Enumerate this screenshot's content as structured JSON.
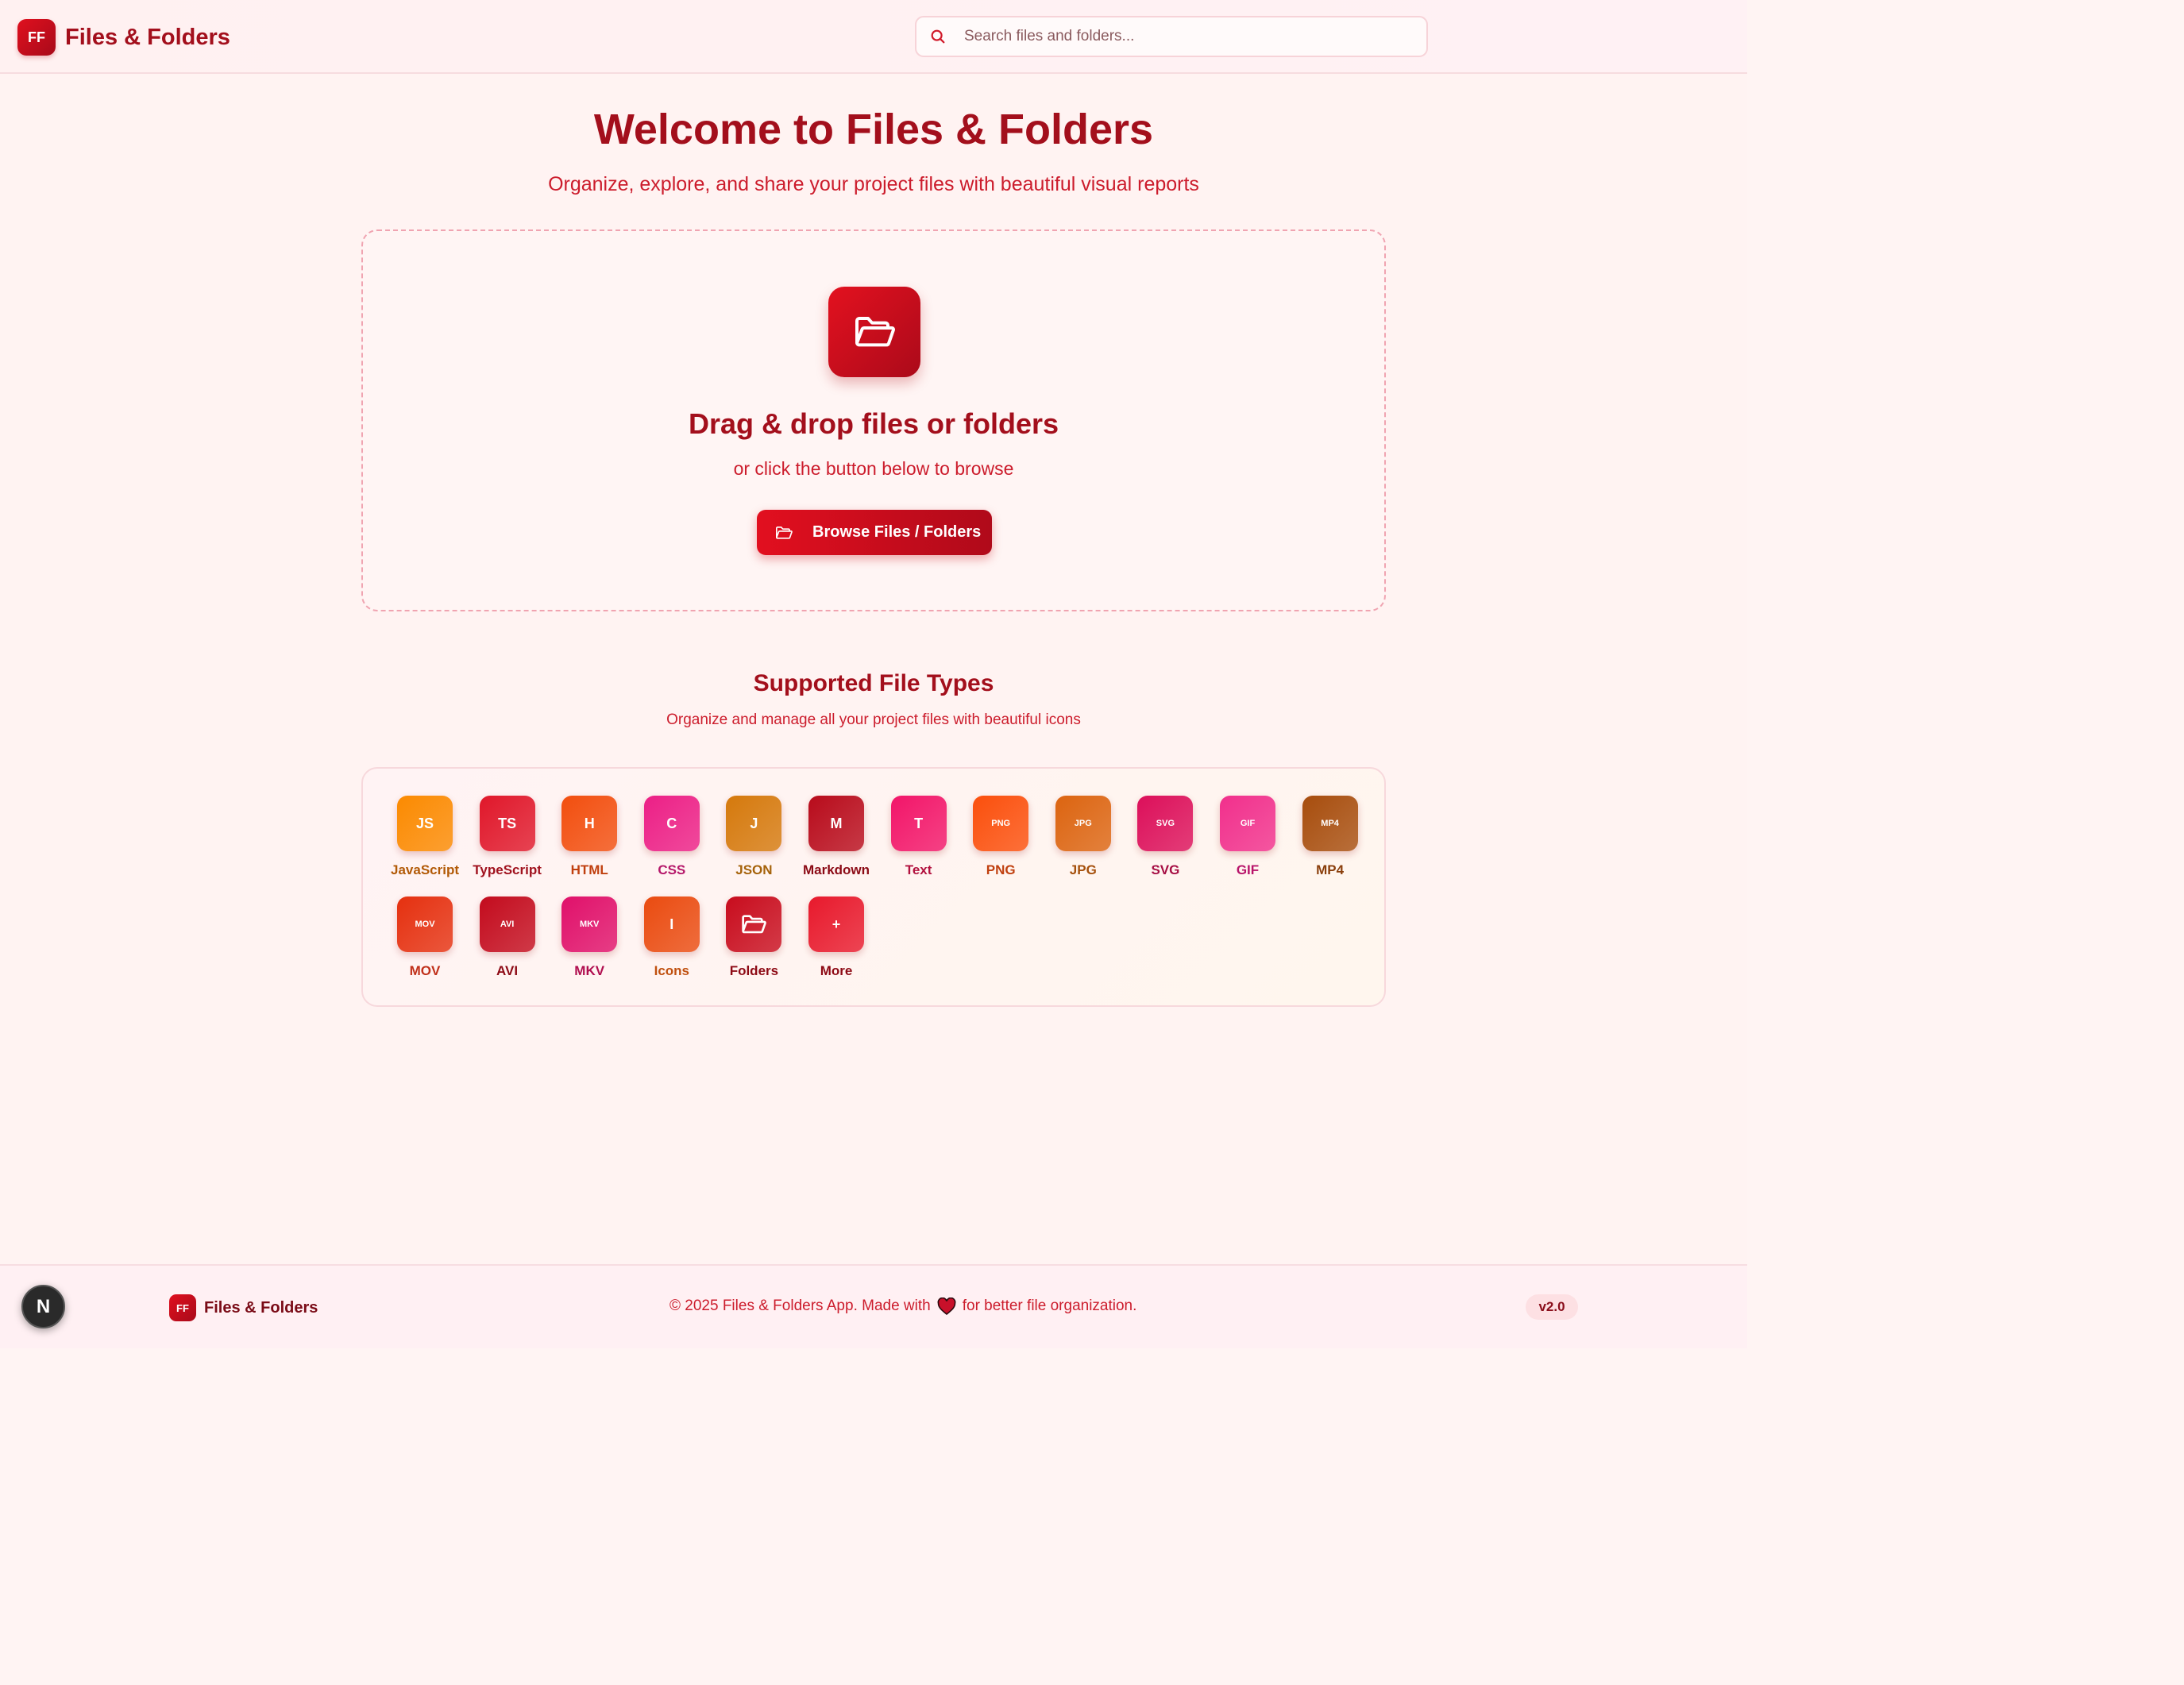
{
  "app": {
    "logo_initials": "FF",
    "name": "Files & Folders"
  },
  "search": {
    "placeholder": "Search files and folders..."
  },
  "hero": {
    "title": "Welcome to Files & Folders",
    "subtitle": "Organize, explore, and share your project files with beautiful visual reports"
  },
  "dropzone": {
    "title": "Drag & drop files or folders",
    "subtitle": "or click the button below to browse",
    "button_label": "Browse Files / Folders"
  },
  "file_types": {
    "title": "Supported File Types",
    "subtitle": "Organize and manage all your project files with beautiful icons",
    "items": [
      {
        "badge": "JS",
        "label": "JavaScript",
        "color": "#fb8a00",
        "text_color": "#b25a06"
      },
      {
        "badge": "TS",
        "label": "TypeScript",
        "color": "#e0172a",
        "text_color": "#a0121e"
      },
      {
        "badge": "H",
        "label": "HTML",
        "color": "#f24e0e",
        "text_color": "#c0400f"
      },
      {
        "badge": "C",
        "label": "CSS",
        "color": "#ec1f86",
        "text_color": "#b5176a"
      },
      {
        "badge": "J",
        "label": "JSON",
        "color": "#d5790c",
        "text_color": "#a5620a"
      },
      {
        "badge": "M",
        "label": "Markdown",
        "color": "#b80b1b",
        "text_color": "#8b0a15"
      },
      {
        "badge": "T",
        "label": "Text",
        "color": "#f21569",
        "text_color": "#b2123f"
      },
      {
        "badge": "PNG",
        "label": "PNG",
        "color": "#fb4f0c",
        "text_color": "#c0400f"
      },
      {
        "badge": "JPG",
        "label": "JPG",
        "color": "#dc6410",
        "text_color": "#a5500c"
      },
      {
        "badge": "SVG",
        "label": "SVG",
        "color": "#dc0f5a",
        "text_color": "#a60e44"
      },
      {
        "badge": "GIF",
        "label": "GIF",
        "color": "#f12f8c",
        "text_color": "#b8146a"
      },
      {
        "badge": "MP4",
        "label": "MP4",
        "color": "#a74d0d",
        "text_color": "#8a3f0c"
      },
      {
        "badge": "MOV",
        "label": "MOV",
        "color": "#e5300f",
        "text_color": "#c0301a"
      },
      {
        "badge": "AVI",
        "label": "AVI",
        "color": "#c30b1d",
        "text_color": "#8d0a15"
      },
      {
        "badge": "MKV",
        "label": "MKV",
        "color": "#e0106a",
        "text_color": "#b00e4f"
      },
      {
        "badge": "I",
        "label": "Icons",
        "color": "#ea4b10",
        "text_color": "#c0500f"
      },
      {
        "badge": "folder-icon",
        "label": "Folders",
        "color": "#c80c1d",
        "text_color": "#8d0a15"
      },
      {
        "badge": "+",
        "label": "More",
        "color": "#e8192c",
        "text_color": "#8d0a15"
      }
    ]
  },
  "footer": {
    "n_button": "N",
    "logo_initials": "FF",
    "name": "Files & Folders",
    "copyright_prefix": "© 2025 Files & Folders App. Made with",
    "copyright_suffix": "for better file organization.",
    "version": "v2.0"
  }
}
